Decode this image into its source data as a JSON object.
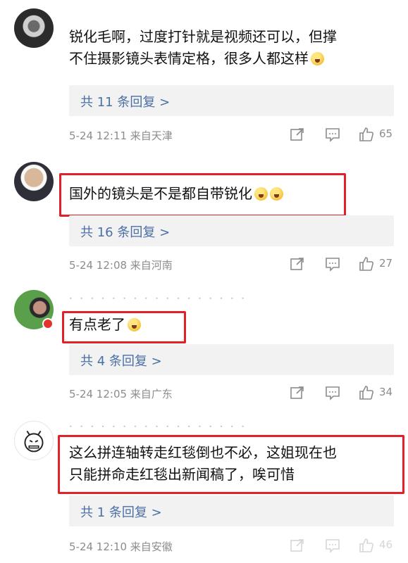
{
  "colors": {
    "highlight": "#e0202a",
    "link": "#4a6fa5",
    "meta": "#8c8c8c"
  },
  "comments": [
    {
      "avatar": "avatar-grayscale-icon",
      "text_line1": "锐化毛啊，过度打针就是视频还可以，但撑",
      "text_line2": "不住摄影镜头表情定格，很多人都这样",
      "emoji": "surprised-face-emoji",
      "replies": "共 11 条回复 >",
      "meta": "5-24 12:11  来自天津",
      "likes": "65"
    },
    {
      "avatar": "avatar-man-glasses-icon",
      "text": "国外的镜头是不是都自带锐化",
      "emoji": "laughing-crying-emoji",
      "replies": "共 16 条回复 >",
      "meta": "5-24 12:08  来自河南",
      "likes": "27"
    },
    {
      "avatar": "avatar-woman-green-icon",
      "text": "有点老了",
      "emoji": "thinking-face-emoji",
      "replies": "共 4 条回复 >",
      "meta": "5-24 12:05  来自广东",
      "likes": "34"
    },
    {
      "avatar": "avatar-cartoon-face-icon",
      "text_line1": "这么拼连轴转走红毯倒也不必，这姐现在也",
      "text_line2": "只能拼命走红毯出新闻稿了，唉可惜",
      "replies": "共 1 条回复 >",
      "meta": "5-24 12:10  来自安徽",
      "likes": "46"
    }
  ],
  "icons": {
    "share": "share-icon",
    "reply": "comment-icon",
    "like": "thumbs-up-icon"
  }
}
